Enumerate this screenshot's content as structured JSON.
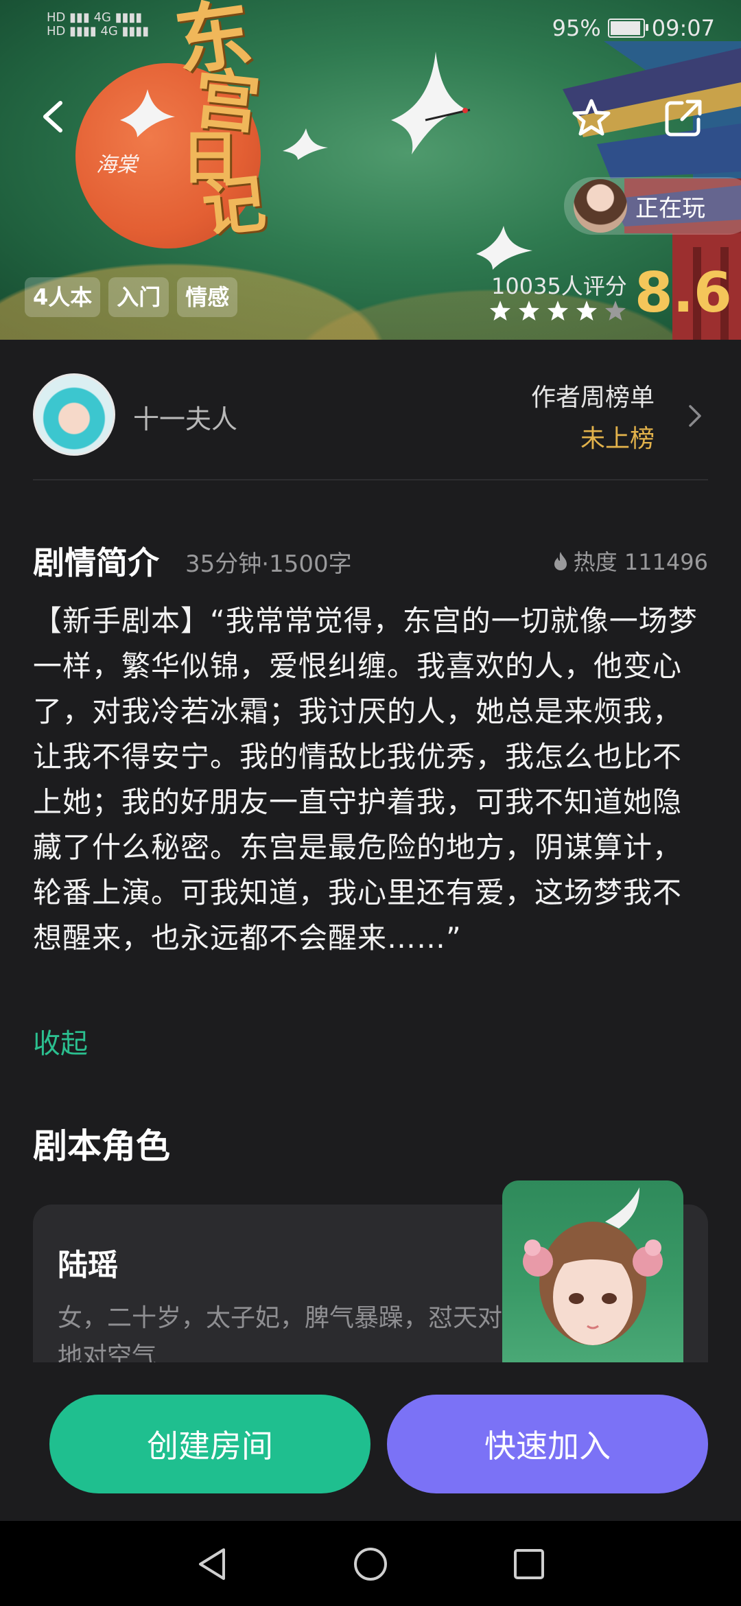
{
  "status_bar": {
    "left_hd1": "HD",
    "left_net": "4G",
    "battery": "95%",
    "battery_level": 0.95,
    "time": "09:07"
  },
  "hero": {
    "title_calligraphy": [
      "东",
      "宫",
      "日",
      "记"
    ],
    "seal_text": "海棠",
    "playing_label": "正在玩",
    "tags": [
      "4人本",
      "入门",
      "情感"
    ],
    "rating_count": "10035人评分",
    "stars_filled": 4,
    "stars_total": 5,
    "score": "8.6"
  },
  "author": {
    "name": "十一夫人",
    "rank_label": "作者周榜单",
    "rank_value": "未上榜"
  },
  "synopsis": {
    "title": "剧情简介",
    "meta": "35分钟·1500字",
    "heat": "热度 111496",
    "text": "【新手剧本】“我常常觉得，东宫的一切就像一场梦一样，繁华似锦，爱恨纠缠。我喜欢的人，他变心了，对我冷若冰霜；我讨厌的人，她总是来烦我，让我不得安宁。我的情敌比我优秀，我怎么也比不上她；我的好朋友一直守护着我，可我不知道她隐藏了什么秘密。东宫是最危险的地方，阴谋算计，轮番上演。可我知道，我心里还有爱，这场梦我不想醒来，也永远都不会醒来……”",
    "collapse": "收起"
  },
  "roles": {
    "title": "剧本角色",
    "items": [
      {
        "name": "陆瑶",
        "desc": "女，二十岁，太子妃，脾气暴躁，怼天对地对空气"
      }
    ]
  },
  "actions": {
    "create": "创建房间",
    "join": "快速加入"
  },
  "colors": {
    "accent_green": "#1fbf8f",
    "accent_purple": "#7b72f6",
    "score_gold": "#f4c65a",
    "rank_gold": "#e2b24b",
    "link_green": "#2bbf8f"
  }
}
